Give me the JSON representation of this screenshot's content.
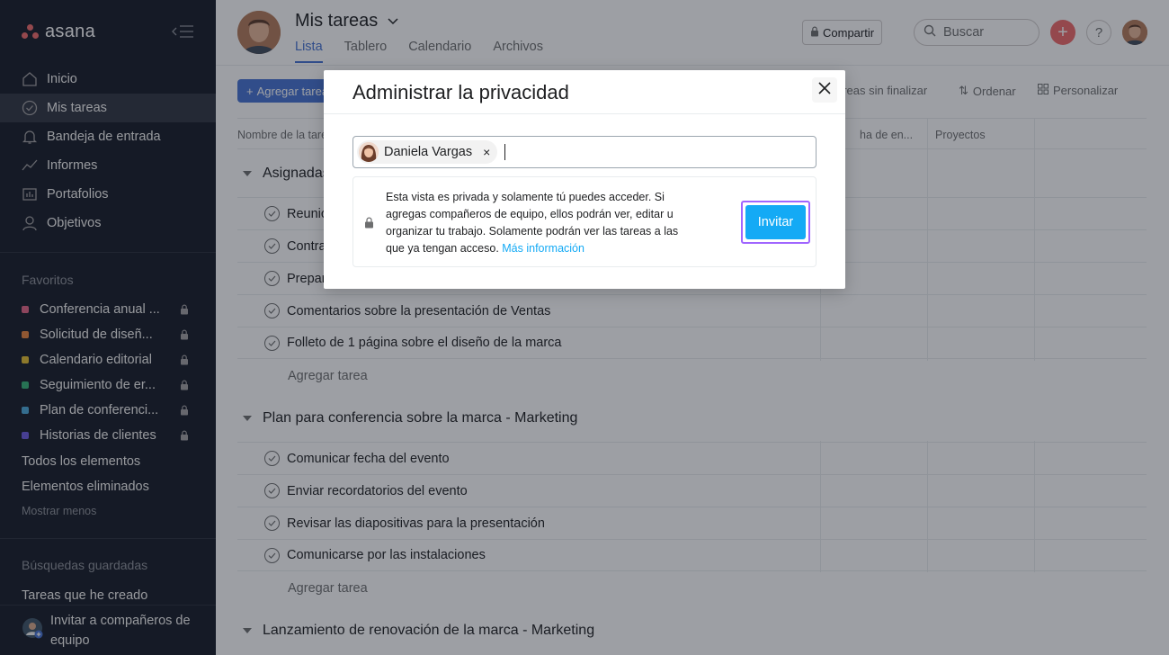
{
  "colors": {
    "sidebar_bg": "#151b26",
    "accent_blue": "#4573d2",
    "invite_blue": "#14aaf5",
    "focus_purple": "#a065ff",
    "logo_coral": "#f06a6a"
  },
  "sidebar": {
    "logo_text": "asana",
    "nav": [
      {
        "label": "Inicio",
        "icon": "home-icon"
      },
      {
        "label": "Mis tareas",
        "icon": "check-circle-icon",
        "active": true
      },
      {
        "label": "Bandeja de entrada",
        "icon": "bell-icon"
      },
      {
        "label": "Informes",
        "icon": "line-chart-icon"
      },
      {
        "label": "Portafolios",
        "icon": "portfolio-icon"
      },
      {
        "label": "Objetivos",
        "icon": "person-icon"
      }
    ],
    "favorites_title": "Favoritos",
    "favorites": [
      {
        "label": "Conferencia anual ...",
        "color": "#e36486"
      },
      {
        "label": "Solicitud de diseñ...",
        "color": "#e8843b"
      },
      {
        "label": "Calendario editorial",
        "color": "#e4bd2f"
      },
      {
        "label": "Seguimiento de er...",
        "color": "#34b376"
      },
      {
        "label": "Plan de conferenci...",
        "color": "#4ba9da"
      },
      {
        "label": "Historias de clientes",
        "color": "#6b5ae0"
      }
    ],
    "all_items": "Todos los elementos",
    "deleted_items": "Elementos eliminados",
    "show_less": "Mostrar menos",
    "saved_searches_title": "Búsquedas guardadas",
    "saved_search_item": "Tareas que he creado",
    "invite_label": "Invitar a compañeros de equipo"
  },
  "header": {
    "title": "Mis tareas",
    "tabs": [
      "Lista",
      "Tablero",
      "Calendario",
      "Archivos"
    ],
    "share_label": "Compartir",
    "search_placeholder": "Buscar",
    "help": "?"
  },
  "toolbar": {
    "add_task": "Agregar tarea",
    "filter": "areas sin finalizar",
    "sort": "Ordenar",
    "customize": "Personalizar"
  },
  "columns": {
    "name": "Nombre de la tarea",
    "due": "ha de en...",
    "projects": "Proyectos"
  },
  "sections": [
    {
      "title": "Asignadas recientemente",
      "tasks": [
        "Reunión",
        "Contrato",
        "Preparar",
        "Comentarios sobre la presentación de Ventas",
        "Folleto de 1 página sobre el diseño de la marca"
      ]
    },
    {
      "title": "Plan para conferencia sobre la marca - Marketing",
      "tasks": [
        "Comunicar fecha del evento",
        "Enviar recordatorios del evento",
        "Revisar las diapositivas para la presentación",
        "Comunicarse por las instalaciones"
      ]
    },
    {
      "title": "Lanzamiento de renovación de la marca - Marketing",
      "tasks": []
    }
  ],
  "add_task_link": "Agregar tarea",
  "modal": {
    "title": "Administrar la privacidad",
    "token_name": "Daniela Vargas",
    "token_remove": "×",
    "info_text": "Esta vista es privada y solamente tú puedes acceder. Si agregas compañeros de equipo, ellos podrán ver, editar u organizar tu trabajo. Solamente podrán ver las tareas a las que ya tengan acceso. ",
    "info_link": "Más información",
    "invite_button": "Invitar"
  }
}
